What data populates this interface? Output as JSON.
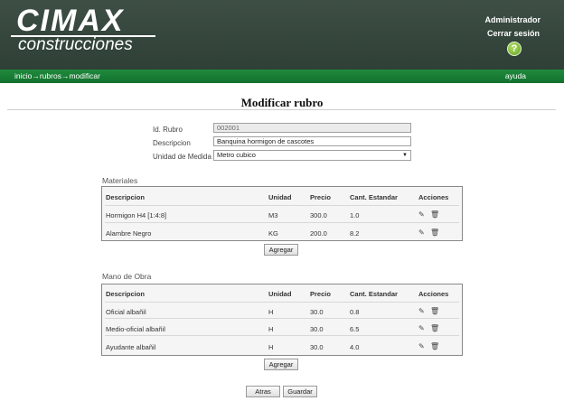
{
  "header": {
    "logo_main": "CIMAX",
    "logo_sub": "construcciones",
    "user_name": "Administrador",
    "logout_label": "Cerrar sesión",
    "help_icon_symbol": "?"
  },
  "nav": {
    "breadcrumb": "inicio→rubros→modificar",
    "help_label": "ayuda"
  },
  "page": {
    "title": "Modificar rubro"
  },
  "form": {
    "id_label": "Id. Rubro",
    "id_value": "002001",
    "desc_label": "Descripcion",
    "desc_value": "Banquina hormigon de cascotes",
    "unit_label": "Unidad de Medida",
    "unit_value": "Metro cubico"
  },
  "columns": {
    "descripcion": "Descripcion",
    "unidad": "Unidad",
    "precio": "Precio",
    "cant": "Cant. Estandar",
    "acciones": "Acciones"
  },
  "materiales": {
    "title": "Materiales",
    "rows": [
      {
        "descripcion": "Hormigon H4 [1:4:8]",
        "unidad": "M3",
        "precio": "300.0",
        "cant": "1.0"
      },
      {
        "descripcion": "Alambre Negro",
        "unidad": "KG",
        "precio": "200.0",
        "cant": "8.2"
      }
    ],
    "add_label": "Agregar"
  },
  "mano_obra": {
    "title": "Mano de Obra",
    "rows": [
      {
        "descripcion": "Oficial albañil",
        "unidad": "H",
        "precio": "30.0",
        "cant": "0.8"
      },
      {
        "descripcion": "Medio-oficial albañil",
        "unidad": "H",
        "precio": "30.0",
        "cant": "6.5"
      },
      {
        "descripcion": "Ayudante albañil",
        "unidad": "H",
        "precio": "30.0",
        "cant": "4.0"
      }
    ],
    "add_label": "Agregar"
  },
  "actions": {
    "back_label": "Atras",
    "save_label": "Guardar"
  },
  "icons": {
    "edit": "pencil-icon",
    "delete": "trash-icon"
  },
  "colors": {
    "header_bg": "#3e4f45",
    "navbar_bg": "#1e8a3c",
    "help_icon": "#6fb628"
  }
}
